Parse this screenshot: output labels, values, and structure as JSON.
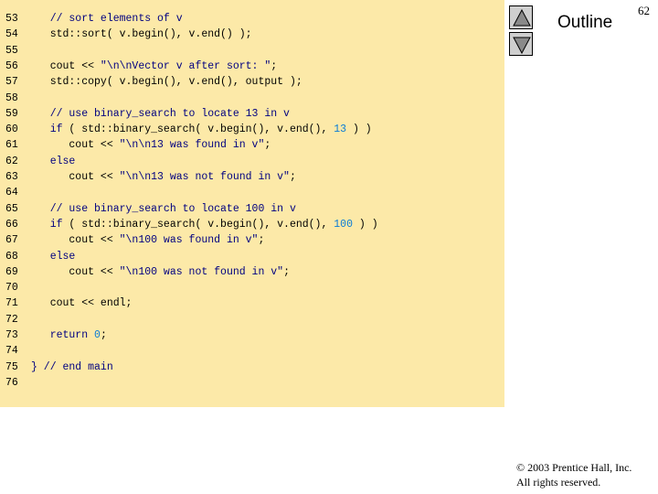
{
  "slide": {
    "page_number": "62",
    "outline_label": "Outline",
    "copyright_line1": "© 2003 Prentice Hall, Inc.",
    "copyright_line2": "All rights reserved."
  },
  "nav": {
    "up_icon": "triangle-up-icon",
    "down_icon": "triangle-down-icon"
  },
  "code_lines": [
    {
      "n": "53",
      "tokens": [
        {
          "t": "   // sort elements of v",
          "c": "comment"
        }
      ]
    },
    {
      "n": "54",
      "tokens": [
        {
          "t": "   std::sort( v.begin(), v.end() );",
          "c": "plain"
        }
      ]
    },
    {
      "n": "55",
      "tokens": []
    },
    {
      "n": "56",
      "tokens": [
        {
          "t": "   cout << ",
          "c": "plain"
        },
        {
          "t": "\"\\n\\nVector v after sort: \"",
          "c": "string"
        },
        {
          "t": ";",
          "c": "plain"
        }
      ]
    },
    {
      "n": "57",
      "tokens": [
        {
          "t": "   std::copy( v.begin(), v.end(), output );",
          "c": "plain"
        }
      ]
    },
    {
      "n": "58",
      "tokens": []
    },
    {
      "n": "59",
      "tokens": [
        {
          "t": "   // use binary_search to locate 13 in v",
          "c": "comment"
        }
      ]
    },
    {
      "n": "60",
      "tokens": [
        {
          "t": "   if",
          "c": "keyword"
        },
        {
          "t": " ( std::binary_search( v.begin(), v.end(), ",
          "c": "plain"
        },
        {
          "t": "13",
          "c": "number"
        },
        {
          "t": " ) )",
          "c": "plain"
        }
      ]
    },
    {
      "n": "61",
      "tokens": [
        {
          "t": "      cout << ",
          "c": "plain"
        },
        {
          "t": "\"\\n\\n13 was found in v\"",
          "c": "string"
        },
        {
          "t": ";",
          "c": "plain"
        }
      ]
    },
    {
      "n": "62",
      "tokens": [
        {
          "t": "   else",
          "c": "keyword"
        }
      ]
    },
    {
      "n": "63",
      "tokens": [
        {
          "t": "      cout << ",
          "c": "plain"
        },
        {
          "t": "\"\\n\\n13 was not found in v\"",
          "c": "string"
        },
        {
          "t": ";",
          "c": "plain"
        }
      ]
    },
    {
      "n": "64",
      "tokens": []
    },
    {
      "n": "65",
      "tokens": [
        {
          "t": "   // use binary_search to locate 100 in v",
          "c": "comment"
        }
      ]
    },
    {
      "n": "66",
      "tokens": [
        {
          "t": "   if",
          "c": "keyword"
        },
        {
          "t": " ( std::binary_search( v.begin(), v.end(), ",
          "c": "plain"
        },
        {
          "t": "100",
          "c": "number"
        },
        {
          "t": " ) )",
          "c": "plain"
        }
      ]
    },
    {
      "n": "67",
      "tokens": [
        {
          "t": "      cout << ",
          "c": "plain"
        },
        {
          "t": "\"\\n100 was found in v\"",
          "c": "string"
        },
        {
          "t": ";",
          "c": "plain"
        }
      ]
    },
    {
      "n": "68",
      "tokens": [
        {
          "t": "   else",
          "c": "keyword"
        }
      ]
    },
    {
      "n": "69",
      "tokens": [
        {
          "t": "      cout << ",
          "c": "plain"
        },
        {
          "t": "\"\\n100 was not found in v\"",
          "c": "string"
        },
        {
          "t": ";",
          "c": "plain"
        }
      ]
    },
    {
      "n": "70",
      "tokens": []
    },
    {
      "n": "71",
      "tokens": [
        {
          "t": "   cout << endl;",
          "c": "plain"
        }
      ]
    },
    {
      "n": "72",
      "tokens": []
    },
    {
      "n": "73",
      "tokens": [
        {
          "t": "   return",
          "c": "keyword"
        },
        {
          "t": " ",
          "c": "plain"
        },
        {
          "t": "0",
          "c": "number"
        },
        {
          "t": ";",
          "c": "plain"
        }
      ]
    },
    {
      "n": "74",
      "tokens": []
    },
    {
      "n": "75",
      "tokens": [
        {
          "t": "} // end main",
          "c": "comment"
        }
      ]
    },
    {
      "n": "76",
      "tokens": []
    }
  ]
}
